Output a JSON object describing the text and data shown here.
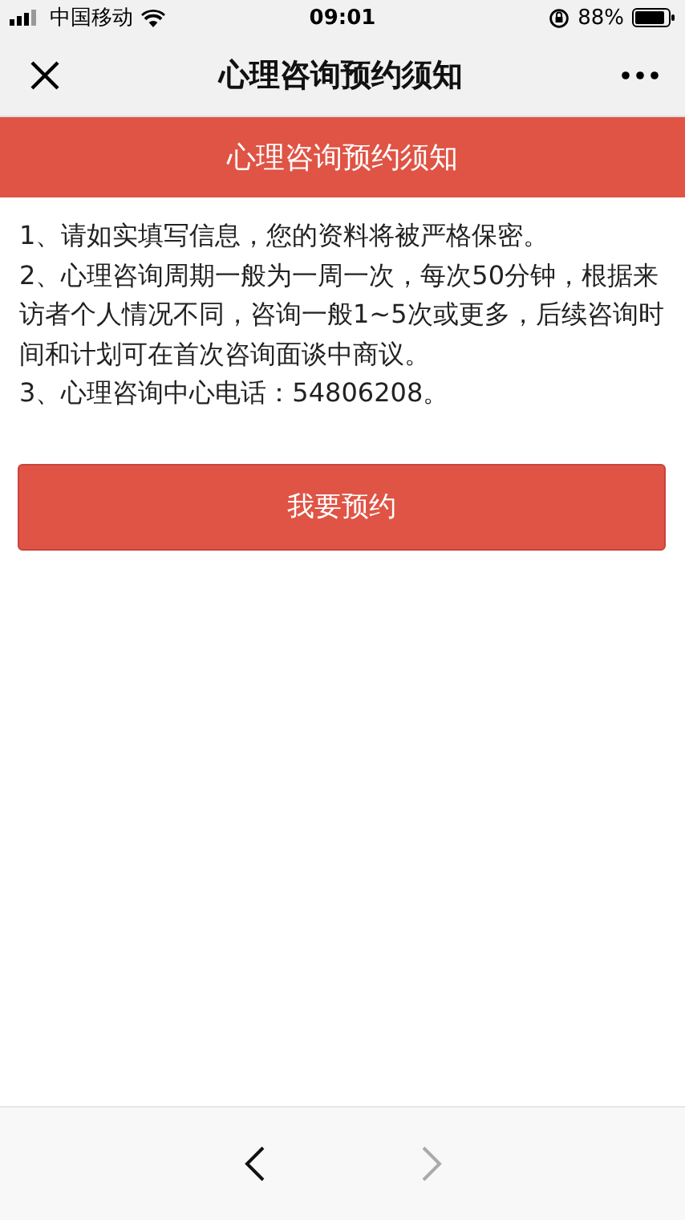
{
  "status_bar": {
    "carrier": "中国移动",
    "time": "09:01",
    "battery": "88%"
  },
  "nav_bar": {
    "title": "心理咨询预约须知"
  },
  "banner": {
    "title": "心理咨询预约须知"
  },
  "notices": [
    "1、请如实填写信息，您的资料将被严格保密。",
    "2、心理咨询周期一般为一周一次，每次50分钟，根据来访者个人情况不同，咨询一般1~5次或更多，后续咨询时间和计划可在首次咨询面谈中商议。",
    "3、心理咨询中心电话：54806208。"
  ],
  "button": {
    "label": "我要预约"
  },
  "bottom_bar": {
    "back": {
      "disabled": false
    },
    "forward": {
      "disabled": true
    }
  }
}
